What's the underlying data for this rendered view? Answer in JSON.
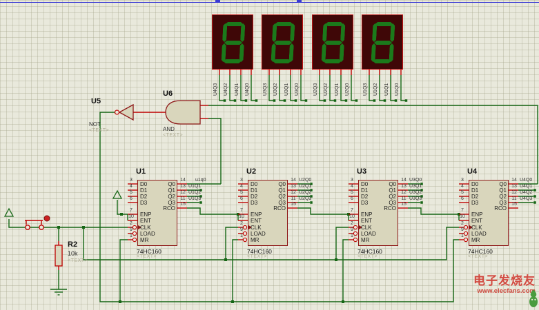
{
  "gates": {
    "u5": {
      "ref": "U5",
      "type": "NOT",
      "placeholder": "<TEXT>"
    },
    "u6": {
      "ref": "U6",
      "type": "AND",
      "placeholder": "<TEXT>"
    }
  },
  "resistor": {
    "ref": "R2",
    "value": "10k",
    "placeholder": "<TEXT>"
  },
  "counters": [
    {
      "ref": "U1",
      "part": "74HC160",
      "placeholder": "<TEXT>",
      "left_pins": [
        {
          "num": "3",
          "name": "D0"
        },
        {
          "num": "4",
          "name": "D1"
        },
        {
          "num": "5",
          "name": "D2"
        },
        {
          "num": "6",
          "name": "D3"
        },
        {
          "num": "7",
          "name": "ENP"
        },
        {
          "num": "10",
          "name": "ENT"
        },
        {
          "num": "2",
          "name": "CLK"
        },
        {
          "num": "9",
          "name": "LOAD"
        },
        {
          "num": "1",
          "name": "MR"
        }
      ],
      "right_pins": [
        {
          "num": "14",
          "name": "Q0",
          "wire_label": "u1q0"
        },
        {
          "num": "13",
          "name": "Q1",
          "wire_label": "U1Q1"
        },
        {
          "num": "12",
          "name": "Q2",
          "wire_label": "U1Q2"
        },
        {
          "num": "11",
          "name": "Q3",
          "wire_label": "U1Q3"
        },
        {
          "num": "15",
          "name": "RCO",
          "wire_label": ""
        }
      ]
    },
    {
      "ref": "U2",
      "part": "74HC160",
      "placeholder": "<TEXT>",
      "left_pins": [
        {
          "num": "3",
          "name": "D0"
        },
        {
          "num": "4",
          "name": "D1"
        },
        {
          "num": "5",
          "name": "D2"
        },
        {
          "num": "6",
          "name": "D3"
        },
        {
          "num": "7",
          "name": "ENP"
        },
        {
          "num": "10",
          "name": "ENT"
        },
        {
          "num": "2",
          "name": "CLK"
        },
        {
          "num": "9",
          "name": "LOAD"
        },
        {
          "num": "1",
          "name": "MR"
        }
      ],
      "right_pins": [
        {
          "num": "14",
          "name": "Q0",
          "wire_label": "U2Q0"
        },
        {
          "num": "13",
          "name": "Q1",
          "wire_label": "U2Q1"
        },
        {
          "num": "12",
          "name": "Q2",
          "wire_label": "U2Q2"
        },
        {
          "num": "11",
          "name": "Q3",
          "wire_label": "U2Q3"
        },
        {
          "num": "15",
          "name": "RCO",
          "wire_label": ""
        }
      ]
    },
    {
      "ref": "U3",
      "part": "74HC160",
      "placeholder": "<TEXT>",
      "left_pins": [
        {
          "num": "3",
          "name": "D0"
        },
        {
          "num": "4",
          "name": "D1"
        },
        {
          "num": "5",
          "name": "D2"
        },
        {
          "num": "6",
          "name": "D3"
        },
        {
          "num": "7",
          "name": "ENP"
        },
        {
          "num": "10",
          "name": "ENT"
        },
        {
          "num": "2",
          "name": "CLK"
        },
        {
          "num": "9",
          "name": "LOAD"
        },
        {
          "num": "1",
          "name": "MR"
        }
      ],
      "right_pins": [
        {
          "num": "14",
          "name": "Q0",
          "wire_label": "U3Q0"
        },
        {
          "num": "13",
          "name": "Q1",
          "wire_label": "U3Q1"
        },
        {
          "num": "12",
          "name": "Q2",
          "wire_label": "U3Q2"
        },
        {
          "num": "11",
          "name": "Q3",
          "wire_label": "U3Q3"
        },
        {
          "num": "15",
          "name": "RCO",
          "wire_label": ""
        }
      ]
    },
    {
      "ref": "U4",
      "part": "74HC160",
      "placeholder": "<TEXT>",
      "left_pins": [
        {
          "num": "3",
          "name": "D0"
        },
        {
          "num": "4",
          "name": "D1"
        },
        {
          "num": "5",
          "name": "D2"
        },
        {
          "num": "6",
          "name": "D3"
        },
        {
          "num": "7",
          "name": "ENP"
        },
        {
          "num": "10",
          "name": "ENT"
        },
        {
          "num": "2",
          "name": "CLK"
        },
        {
          "num": "9",
          "name": "LOAD"
        },
        {
          "num": "1",
          "name": "MR"
        }
      ],
      "right_pins": [
        {
          "num": "14",
          "name": "Q0",
          "wire_label": "U4Q0"
        },
        {
          "num": "13",
          "name": "Q1",
          "wire_label": "U4Q1"
        },
        {
          "num": "12",
          "name": "Q2",
          "wire_label": "U4Q2"
        },
        {
          "num": "11",
          "name": "Q3",
          "wire_label": "U4Q3"
        },
        {
          "num": "15",
          "name": "RCO",
          "wire_label": ""
        }
      ]
    }
  ],
  "displays": [
    {
      "value": "8",
      "pin_labels": [
        "U4Q3",
        "U4Q2",
        "U4Q1",
        "U4Q0"
      ]
    },
    {
      "value": "8",
      "pin_labels": [
        "U3Q3",
        "U3Q2",
        "U3Q1",
        "U3Q0"
      ]
    },
    {
      "value": "8",
      "pin_labels": [
        "U2Q3",
        "U2Q2",
        "U2Q1",
        "U2Q0"
      ]
    },
    {
      "value": "8",
      "pin_labels": [
        "U1Q3",
        "U1Q2",
        "U1Q1",
        "U1Q0"
      ]
    }
  ],
  "watermark": {
    "brand": "电子发烧友",
    "site": "www.elecfans.com"
  },
  "colors": {
    "wire": "#156615",
    "pin": "#c00000",
    "outline": "#8d1717",
    "body_fill": "#d9d6bc",
    "background": "#e9e9dc",
    "display_bg": "#3f0707",
    "segment": "#1b7a1b",
    "display_border": "#c51414",
    "actuator_red": "#cc2222",
    "sheet_border_blue": "#3b3bd4",
    "watermark_red": "#d14b41",
    "mascot_green": "#4a9c3f"
  }
}
